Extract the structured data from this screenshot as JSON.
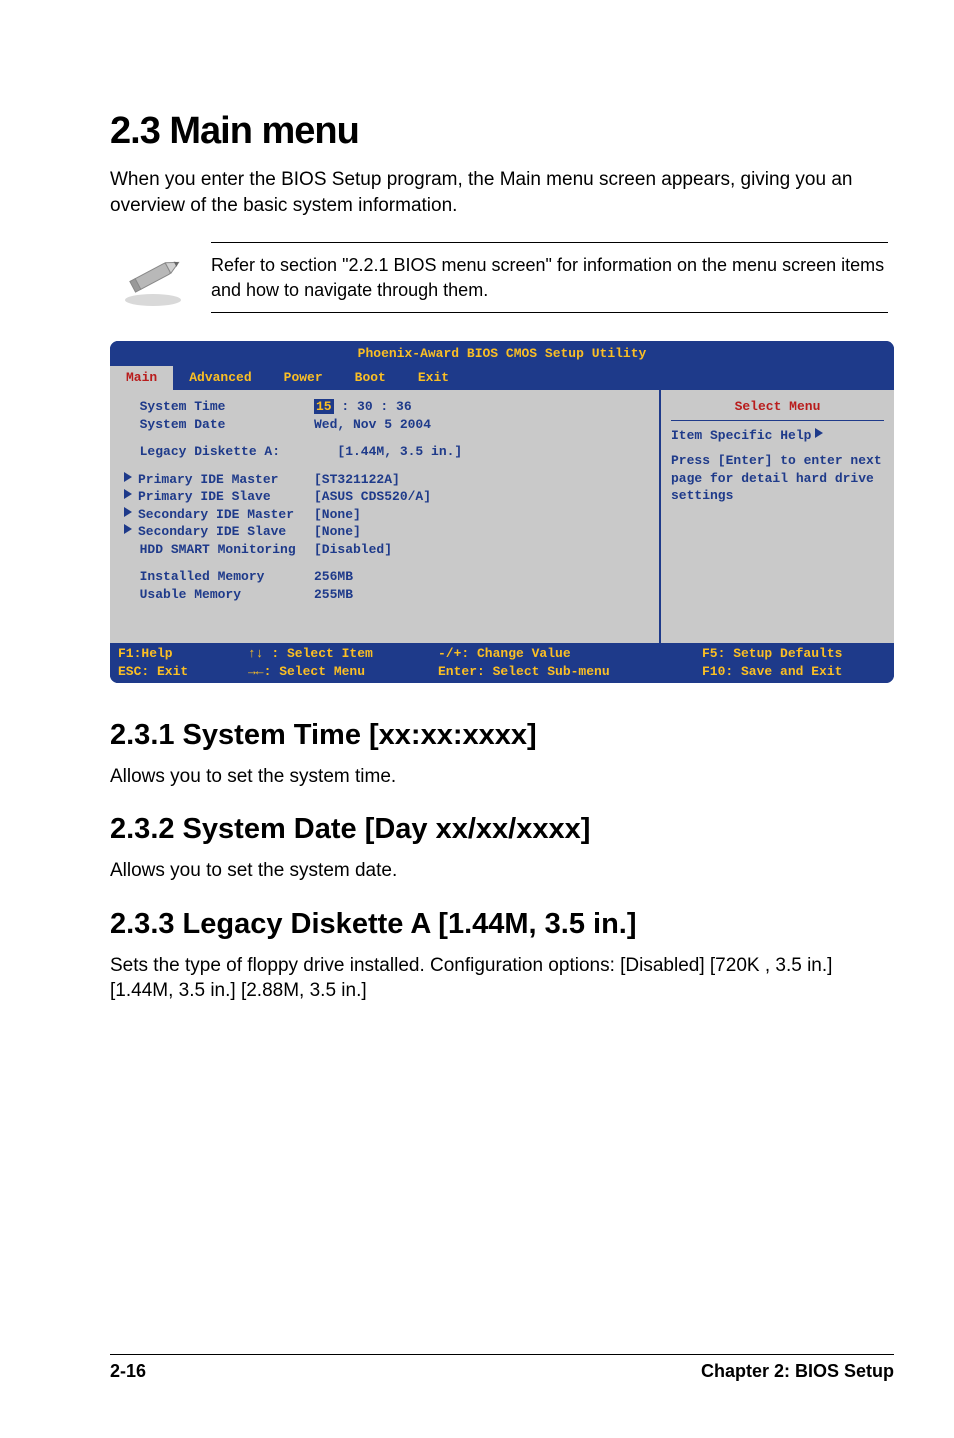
{
  "title": "2.3    Main menu",
  "intro": "When you enter the BIOS Setup program, the Main menu screen appears, giving you an overview of the basic system information.",
  "note": "Refer to section \"2.2.1  BIOS menu screen\" for information on the menu screen items and how to navigate through them.",
  "bios": {
    "title": "Phoenix-Award BIOS CMOS Setup Utility",
    "tabs": [
      "Main",
      "Advanced",
      "Power",
      "Boot",
      "Exit"
    ],
    "time": {
      "label": "System Time",
      "hour": "15",
      "rest": " : 30 : 36"
    },
    "date": {
      "label": "System Date",
      "value": "Wed, Nov 5 2004"
    },
    "legacy": {
      "label": "Legacy Diskette A:",
      "value": "[1.44M, 3.5 in.]"
    },
    "pmaster": {
      "label": "Primary IDE Master",
      "value": "[ST321122A]"
    },
    "pslave": {
      "label": "Primary IDE Slave",
      "value": "[ASUS CDS520/A]"
    },
    "smaster": {
      "label": "Secondary IDE Master",
      "value": "[None]"
    },
    "sslave": {
      "label": "Secondary IDE Slave",
      "value": "[None]"
    },
    "hdd": {
      "label": "HDD SMART Monitoring",
      "value": "[Disabled]"
    },
    "installed": {
      "label": "Installed Memory",
      "value": "256MB"
    },
    "usable": {
      "label": "Usable Memory",
      "value": "255MB"
    },
    "help_title": "Select Menu",
    "help_top": "Item Specific Help",
    "help_body": "Press [Enter] to enter next page for detail hard drive settings",
    "footer": {
      "f1": "F1:Help",
      "esc": "ESC: Exit",
      "sel_item": "↑↓ : Select Item",
      "sel_menu": "→←: Select Menu",
      "change": "-/+: Change Value",
      "enter": "Enter: Select Sub-menu",
      "f5": "F5: Setup Defaults",
      "f10": "F10: Save and Exit"
    }
  },
  "sections": {
    "s1": {
      "heading": "2.3.1   System Time [xx:xx:xxxx]",
      "text": "Allows you to set the system time."
    },
    "s2": {
      "heading": "2.3.2   System Date [Day xx/xx/xxxx]",
      "text": "Allows you to set the system date."
    },
    "s3": {
      "heading": "2.3.3   Legacy Diskette A [1.44M, 3.5 in.]",
      "text": "Sets the type of floppy drive installed. Configuration options: [Disabled]  [720K , 3.5 in.] [1.44M, 3.5 in.] [2.88M, 3.5 in.]"
    }
  },
  "footer": {
    "page": "2-16",
    "chapter": "Chapter 2: BIOS Setup"
  }
}
